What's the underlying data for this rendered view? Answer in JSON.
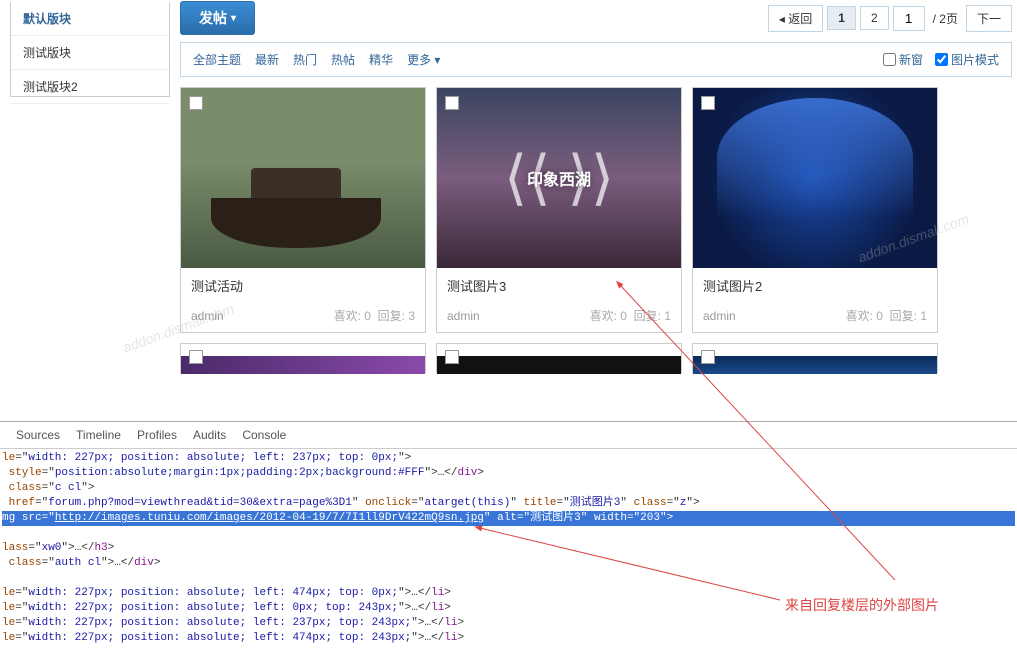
{
  "sidebar": {
    "items": [
      {
        "label": "默认版块",
        "active": true
      },
      {
        "label": "测试版块",
        "active": false
      },
      {
        "label": "测试版块2",
        "active": false
      }
    ]
  },
  "toolbar": {
    "post_label": "发帖"
  },
  "pager": {
    "back": "◂ 返回",
    "p1": "1",
    "p2": "2",
    "input_value": "1",
    "total": "/ 2页",
    "next": "下一"
  },
  "filters": {
    "all": "全部主题",
    "newest": "最新",
    "hot": "热门",
    "hot_posts": "热帖",
    "essence": "精华",
    "more": "更多 ▾"
  },
  "view_modes": {
    "new_window": "新窗",
    "image_mode": "图片模式"
  },
  "cards": [
    {
      "title": "测试活动",
      "author": "admin",
      "likes": "喜欢: 0",
      "replies": "回复: 3"
    },
    {
      "title": "测试图片3",
      "author": "admin",
      "likes": "喜欢: 0",
      "replies": "回复: 1"
    },
    {
      "title": "测试图片2",
      "author": "admin",
      "likes": "喜欢: 0",
      "replies": "回复: 1"
    }
  ],
  "watermark": "addon.dismall.com",
  "devtools": {
    "tabs": [
      "Sources",
      "Timeline",
      "Profiles",
      "Audits",
      "Console"
    ],
    "lines": [
      "le=\"width: 227px; position: absolute; left: 237px; top: 0px;\">",
      "style=\"position:absolute;margin:1px;padding:2px;background:#FFF\">…</div>",
      "class=\"c cl\">",
      "href=\"forum.php?mod=viewthread&tid=30&extra=page%3D1\" onclick=\"atarget(this)\" title=\"测试图片3\" class=\"z\">",
      "mg src=\"http://images.tuniu.com/images/2012-04-19/7/7I1ll9DrV422mQ9sn.jpg\" alt=\"测试图片3\" width=\"203\">",
      "",
      "lass=\"xw0\">…</h3>",
      "class=\"auth cl\">…</div>",
      "",
      "le=\"width: 227px; position: absolute; left: 474px; top: 0px;\">…</li>",
      "le=\"width: 227px; position: absolute; left: 0px; top: 243px;\">…</li>",
      "le=\"width: 227px; position: absolute; left: 237px; top: 243px;\">…</li>",
      "le=\"width: 227px; position: absolute; left: 474px; top: 243px;\">…</li>"
    ]
  },
  "annotation": "来自回复楼层的外部图片"
}
